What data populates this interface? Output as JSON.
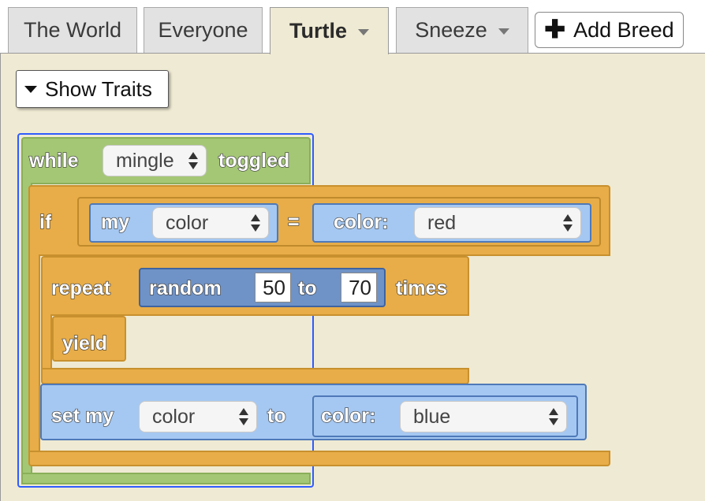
{
  "tabs": [
    {
      "label": "The World",
      "active": false,
      "dropdown": false
    },
    {
      "label": "Everyone",
      "active": false,
      "dropdown": false
    },
    {
      "label": "Turtle",
      "active": true,
      "dropdown": true
    },
    {
      "label": "Sneeze",
      "active": false,
      "dropdown": true
    }
  ],
  "add_breed": {
    "icon": "plus-icon",
    "label": "Add Breed"
  },
  "show_traits": {
    "icon": "caret-down-icon",
    "label": "Show Traits"
  },
  "blocks": {
    "while": {
      "label": "while",
      "dropdown": "mingle",
      "suffix": "toggled"
    },
    "if": {
      "label": "if",
      "left_label": "my",
      "left_value": "color",
      "operator": "=",
      "right_label": "color:",
      "right_value": "red"
    },
    "repeat": {
      "label": "repeat",
      "random_label": "random",
      "min": "50",
      "to_label": "to",
      "max": "70",
      "suffix": "times"
    },
    "yield": {
      "label": "yield"
    },
    "set": {
      "label": "set my",
      "property": "color",
      "to_label": "to",
      "color_label": "color:",
      "color_value": "blue"
    }
  },
  "colors": {
    "panel_bg": "#efead3",
    "control_block": "#e8ad48",
    "event_block": "#a4c775",
    "value_block": "#a5c8f2",
    "selection": "#2f5cff"
  }
}
